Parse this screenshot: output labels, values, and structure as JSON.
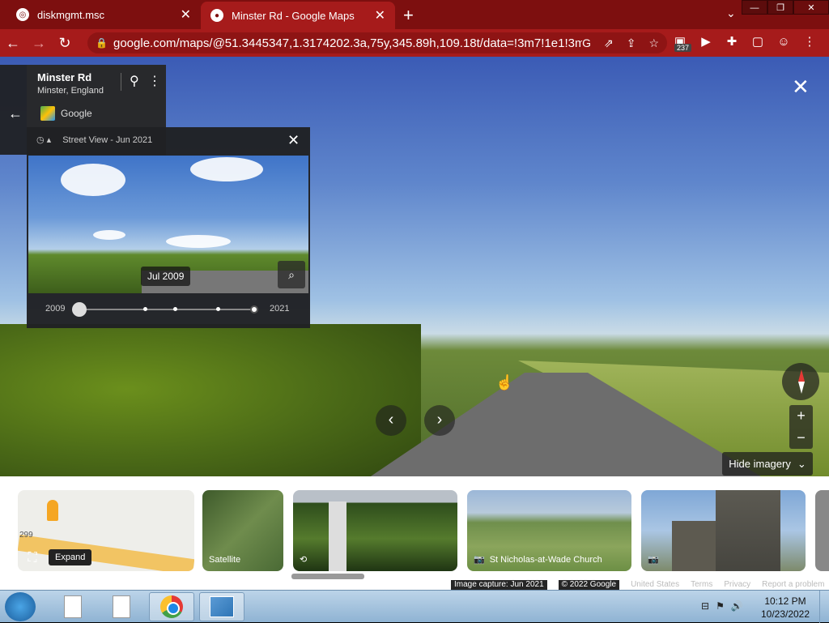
{
  "browser": {
    "tabs": [
      {
        "title": "diskmgmt.msc",
        "active": false
      },
      {
        "title": "Minster Rd - Google Maps",
        "active": true
      }
    ],
    "url": "google.com/maps/@51.3445347,1.3174202.3a,75y,345.89h,109.18t/data=!3m7!1e1!3m...",
    "extension_badge": "237",
    "window_buttons": {
      "minimize": "—",
      "restore": "❐",
      "close": "✕"
    }
  },
  "place": {
    "street": "Minster Rd",
    "locality": "Minster, England",
    "source": "Google"
  },
  "history": {
    "header": "Street View - Jun 2021",
    "date_chip": "Jul 2009",
    "year_start": "2009",
    "year_end": "2021"
  },
  "controls": {
    "hide_imagery": "Hide imagery",
    "zoom_in": "+",
    "zoom_out": "−"
  },
  "strip": {
    "expand_tooltip": "Expand",
    "map_label": "299",
    "satellite_label": "Satellite",
    "church_label": "St Nicholas-at-Wade Church"
  },
  "footer": {
    "capture": "Image capture: Jun 2021",
    "copyright": "© 2022 Google",
    "links": [
      "United States",
      "Terms",
      "Privacy",
      "Report a problem"
    ]
  },
  "taskbar": {
    "time": "10:12 PM",
    "date": "10/23/2022"
  },
  "colors": {
    "tabbar": "#7d0f0f",
    "toolbar": "#a61b1b",
    "active_tab": "#a61b1b"
  }
}
